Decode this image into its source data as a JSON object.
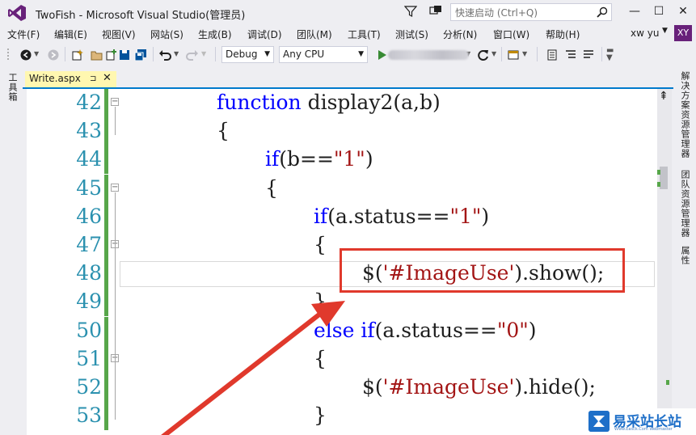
{
  "window": {
    "title": "TwoFish - Microsoft Visual Studio(管理员)",
    "quick_launch_placeholder": "快速启动 (Ctrl+Q)",
    "controls": {
      "minimize": "—",
      "maximize": "☐",
      "close": "✕"
    }
  },
  "menu": [
    "文件(F)",
    "编辑(E)",
    "视图(V)",
    "网站(S)",
    "生成(B)",
    "调试(D)",
    "团队(M)",
    "工具(T)",
    "测试(S)",
    "分析(N)",
    "窗口(W)",
    "帮助(H)"
  ],
  "user": {
    "name": "xw yu",
    "initials": "XY"
  },
  "toolbar": {
    "configuration": "Debug",
    "platform": "Any CPU"
  },
  "left_panel": {
    "toolbox": "工具箱"
  },
  "right_panel": [
    "解决方案资源管理器",
    "团队资源管理器",
    "属性"
  ],
  "document_tab": {
    "label": "Write.aspx",
    "pin": "⊐",
    "close": "✕"
  },
  "editor": {
    "lines": [
      {
        "number": "42",
        "indent": 1,
        "tokens": [
          [
            "kw",
            "function"
          ],
          [
            "fn",
            " display2(a,b)"
          ]
        ]
      },
      {
        "number": "43",
        "indent": 1,
        "tokens": [
          [
            "fn",
            "{"
          ]
        ]
      },
      {
        "number": "44",
        "indent": 2,
        "tokens": [
          [
            "kw",
            "if"
          ],
          [
            "fn",
            "(b=="
          ],
          [
            "str",
            "\"1\""
          ],
          [
            "fn",
            ")"
          ]
        ]
      },
      {
        "number": "45",
        "indent": 2,
        "tokens": [
          [
            "fn",
            "{"
          ]
        ]
      },
      {
        "number": "46",
        "indent": 3,
        "tokens": [
          [
            "kw",
            "if"
          ],
          [
            "fn",
            "(a.status=="
          ],
          [
            "str",
            "\"1\""
          ],
          [
            "fn",
            ")"
          ]
        ]
      },
      {
        "number": "47",
        "indent": 3,
        "tokens": [
          [
            "fn",
            "{"
          ]
        ]
      },
      {
        "number": "48",
        "indent": 4,
        "tokens": [
          [
            "fn",
            "$("
          ],
          [
            "str",
            "'#ImageUse'"
          ],
          [
            "fn",
            ").show();"
          ]
        ]
      },
      {
        "number": "49",
        "indent": 3,
        "tokens": [
          [
            "fn",
            "}"
          ]
        ]
      },
      {
        "number": "50",
        "indent": 3,
        "tokens": [
          [
            "kw",
            "else if"
          ],
          [
            "fn",
            "(a.status=="
          ],
          [
            "str",
            "\"0\""
          ],
          [
            "fn",
            ")"
          ]
        ]
      },
      {
        "number": "51",
        "indent": 3,
        "tokens": [
          [
            "fn",
            "{"
          ]
        ]
      },
      {
        "number": "52",
        "indent": 4,
        "tokens": [
          [
            "fn",
            "$("
          ],
          [
            "str",
            "'#ImageUse'"
          ],
          [
            "fn",
            ").hide();"
          ]
        ]
      },
      {
        "number": "53",
        "indent": 3,
        "tokens": [
          [
            "fn",
            "}"
          ]
        ]
      }
    ]
  },
  "watermark": {
    "text": "易采站长站",
    "sub": "Www.Easck.Com  Webmaster"
  },
  "colors": {
    "keyword": "#0000ff",
    "string": "#a31515",
    "line_number": "#2b91af",
    "accent": "#007acc",
    "annotation": "#e0392c"
  }
}
